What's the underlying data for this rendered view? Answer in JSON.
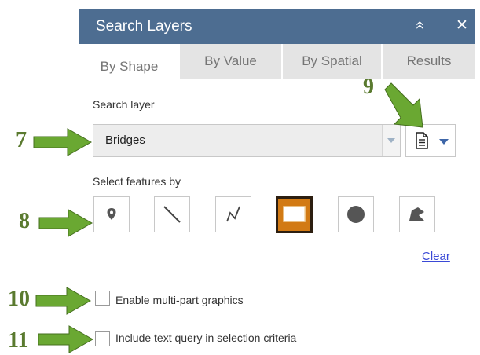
{
  "panel": {
    "title": "Search Layers",
    "collapse_symbol": "»",
    "close_symbol": "✕"
  },
  "tabs": [
    {
      "label": "By Shape",
      "active": true
    },
    {
      "label": "By Value",
      "active": false
    },
    {
      "label": "By Spatial",
      "active": false
    },
    {
      "label": "Results",
      "active": false
    }
  ],
  "search_layer": {
    "label": "Search layer",
    "selected": "Bridges"
  },
  "select_features": {
    "label": "Select features by",
    "tools": [
      {
        "name": "point",
        "icon": "map-pin-icon",
        "active": false
      },
      {
        "name": "line",
        "icon": "line-icon",
        "active": false
      },
      {
        "name": "polyline",
        "icon": "polyline-icon",
        "active": false
      },
      {
        "name": "extent",
        "icon": "rectangle-icon",
        "active": true
      },
      {
        "name": "circle",
        "icon": "circle-icon",
        "active": false
      },
      {
        "name": "polygon",
        "icon": "polygon-icon",
        "active": false
      }
    ],
    "clear_label": "Clear"
  },
  "checkboxes": [
    {
      "label": "Enable multi-part graphics",
      "checked": false
    },
    {
      "label": "Include text query in selection criteria",
      "checked": false
    }
  ],
  "callouts": [
    "7",
    "8",
    "9",
    "10",
    "11"
  ],
  "colors": {
    "header": "#4d6d91",
    "active_tool": "#d27a14",
    "callout": "#5a7a2f",
    "arrow": "#6aa832",
    "link": "#3a49d6"
  }
}
